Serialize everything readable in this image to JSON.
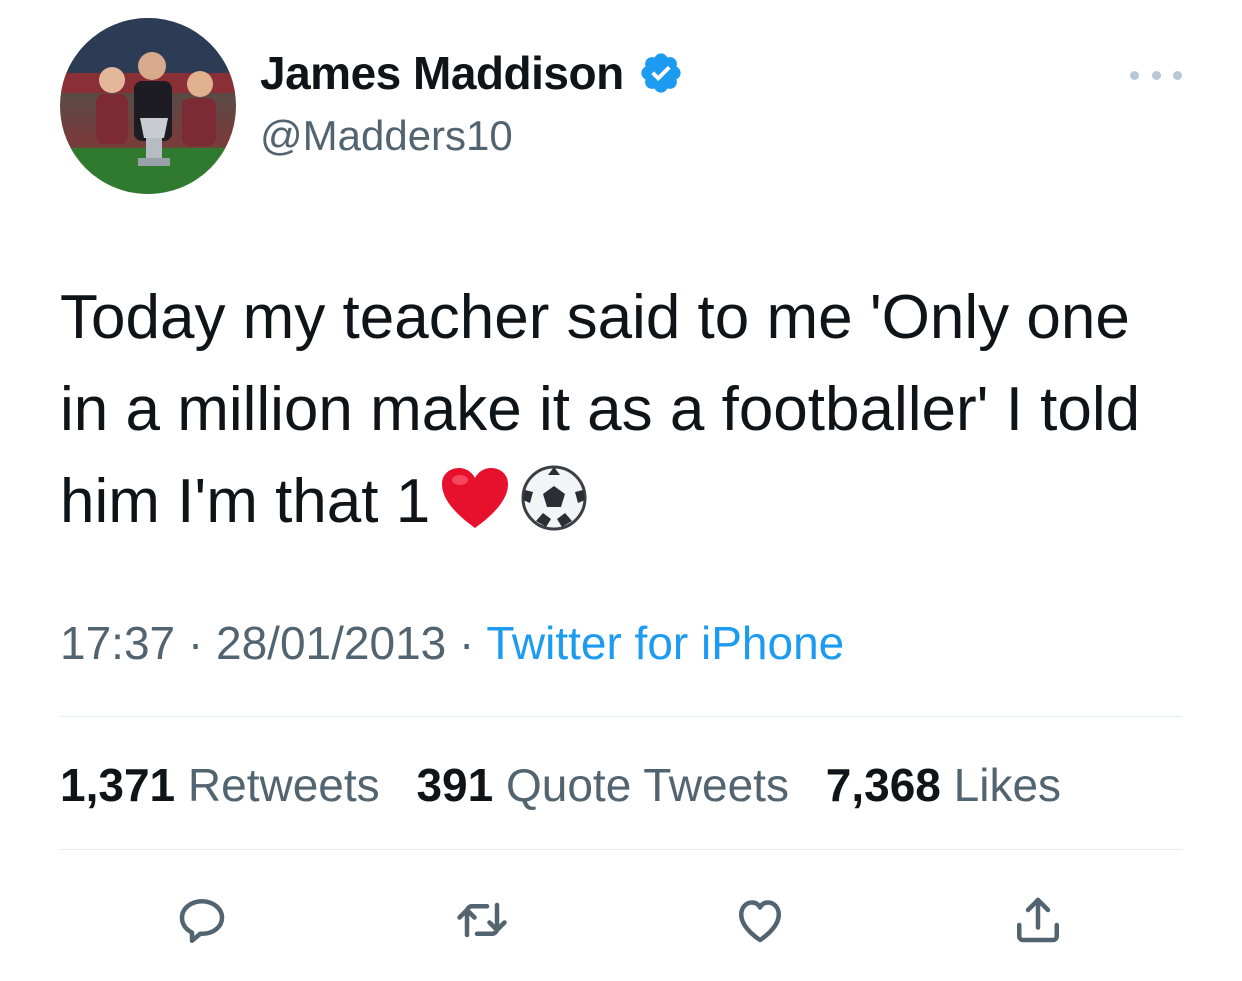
{
  "author": {
    "display_name": "James Maddison",
    "handle": "@Madders10",
    "verified": true,
    "avatar_icon": "profile-photo"
  },
  "tweet": {
    "text": "Today my teacher said to me 'Only one in a million make it as a footballer' I told him I'm that 1",
    "emojis": [
      "red-heart-emoji",
      "soccer-ball-emoji"
    ]
  },
  "meta": {
    "time": "17:37",
    "separator": "·",
    "date": "28/01/2013",
    "source": "Twitter for iPhone"
  },
  "stats": {
    "retweets_count": "1,371",
    "retweets_label": "Retweets",
    "quotes_count": "391",
    "quotes_label": "Quote Tweets",
    "likes_count": "7,368",
    "likes_label": "Likes"
  },
  "actions": [
    "reply-icon",
    "retweet-icon",
    "like-icon",
    "share-icon"
  ],
  "colors": {
    "text": "#0f1419",
    "secondary": "#536471",
    "accent": "#1d9bf0",
    "divider": "#e6ecf0"
  }
}
